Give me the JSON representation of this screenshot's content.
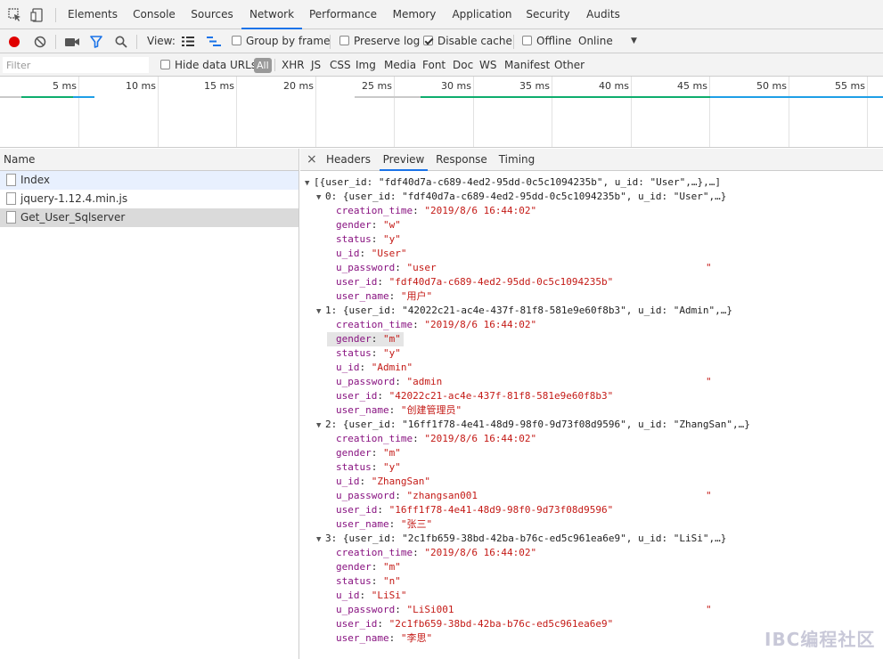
{
  "tabs": [
    "Elements",
    "Console",
    "Sources",
    "Network",
    "Performance",
    "Memory",
    "Application",
    "Security",
    "Audits"
  ],
  "toolbar": {
    "view_label": "View:",
    "group_by_frame": "Group by frame",
    "preserve_log": "Preserve log",
    "disable_cache": "Disable cache",
    "offline": "Offline",
    "throttle_value": "Online",
    "dropdown_glyph": "▼"
  },
  "filter": {
    "placeholder": "Filter",
    "hide_data_urls": "Hide data URLs",
    "all": "All",
    "types": [
      "XHR",
      "JS",
      "CSS",
      "Img",
      "Media",
      "Font",
      "Doc",
      "WS",
      "Manifest",
      "Other"
    ]
  },
  "timeline": {
    "ticks": [
      "5 ms",
      "10 ms",
      "15 ms",
      "20 ms",
      "25 ms",
      "30 ms",
      "35 ms",
      "40 ms",
      "45 ms",
      "50 ms",
      "55 ms"
    ]
  },
  "requests": {
    "header": "Name",
    "items": [
      "Index",
      "jquery-1.12.4.min.js",
      "Get_User_Sqlserver"
    ]
  },
  "detail": {
    "close": "×",
    "tabs": [
      "Headers",
      "Preview",
      "Response",
      "Timing"
    ]
  },
  "preview": {
    "root": "[{user_id: \"fdf40d7a-c689-4ed2-95dd-0c5c1094235b\", u_id: \"User\",…},…]",
    "keys": {
      "creation_time": "creation_time",
      "gender": "gender",
      "status": "status",
      "u_id": "u_id",
      "u_password": "u_password",
      "user_id": "user_id",
      "user_name": "user_name"
    },
    "records": [
      {
        "summary": "0: {user_id: \"fdf40d7a-c689-4ed2-95dd-0c5c1094235b\", u_id: \"User\",…}",
        "creation_time": "\"2019/8/6 16:44:02\"",
        "gender": "\"w\"",
        "status": "\"y\"",
        "u_id": "\"User\"",
        "u_password": "\"user",
        "user_id": "\"fdf40d7a-c689-4ed2-95dd-0c5c1094235b\"",
        "user_name": "\"用户\""
      },
      {
        "summary": "1: {user_id: \"42022c21-ac4e-437f-81f8-581e9e60f8b3\", u_id: \"Admin\",…}",
        "creation_time": "\"2019/8/6 16:44:02\"",
        "gender": "\"m\"",
        "status": "\"y\"",
        "u_id": "\"Admin\"",
        "u_password": "\"admin",
        "user_id": "\"42022c21-ac4e-437f-81f8-581e9e60f8b3\"",
        "user_name": "\"创建管理员\""
      },
      {
        "summary": "2: {user_id: \"16ff1f78-4e41-48d9-98f0-9d73f08d9596\", u_id: \"ZhangSan\",…}",
        "creation_time": "\"2019/8/6 16:44:02\"",
        "gender": "\"m\"",
        "status": "\"y\"",
        "u_id": "\"ZhangSan\"",
        "u_password": "\"zhangsan001",
        "user_id": "\"16ff1f78-4e41-48d9-98f0-9d73f08d9596\"",
        "user_name": "\"张三\""
      },
      {
        "summary": "3: {user_id: \"2c1fb659-38bd-42ba-b76c-ed5c961ea6e9\", u_id: \"LiSi\",…}",
        "creation_time": "\"2019/8/6 16:44:02\"",
        "gender": "\"m\"",
        "status": "\"n\"",
        "u_id": "\"LiSi\"",
        "u_password": "\"LiSi001",
        "user_id": "\"2c1fb659-38bd-42ba-b76c-ed5c961ea6e9\"",
        "user_name": "\"李思\""
      }
    ],
    "password_closing_quote": "\""
  },
  "watermark": "IBC编程社区",
  "colors": {
    "accent": "#1a73e8",
    "record_red": "#e00000",
    "filter_blue": "#1a73e8",
    "key": "#881280",
    "string": "#c41a16"
  }
}
